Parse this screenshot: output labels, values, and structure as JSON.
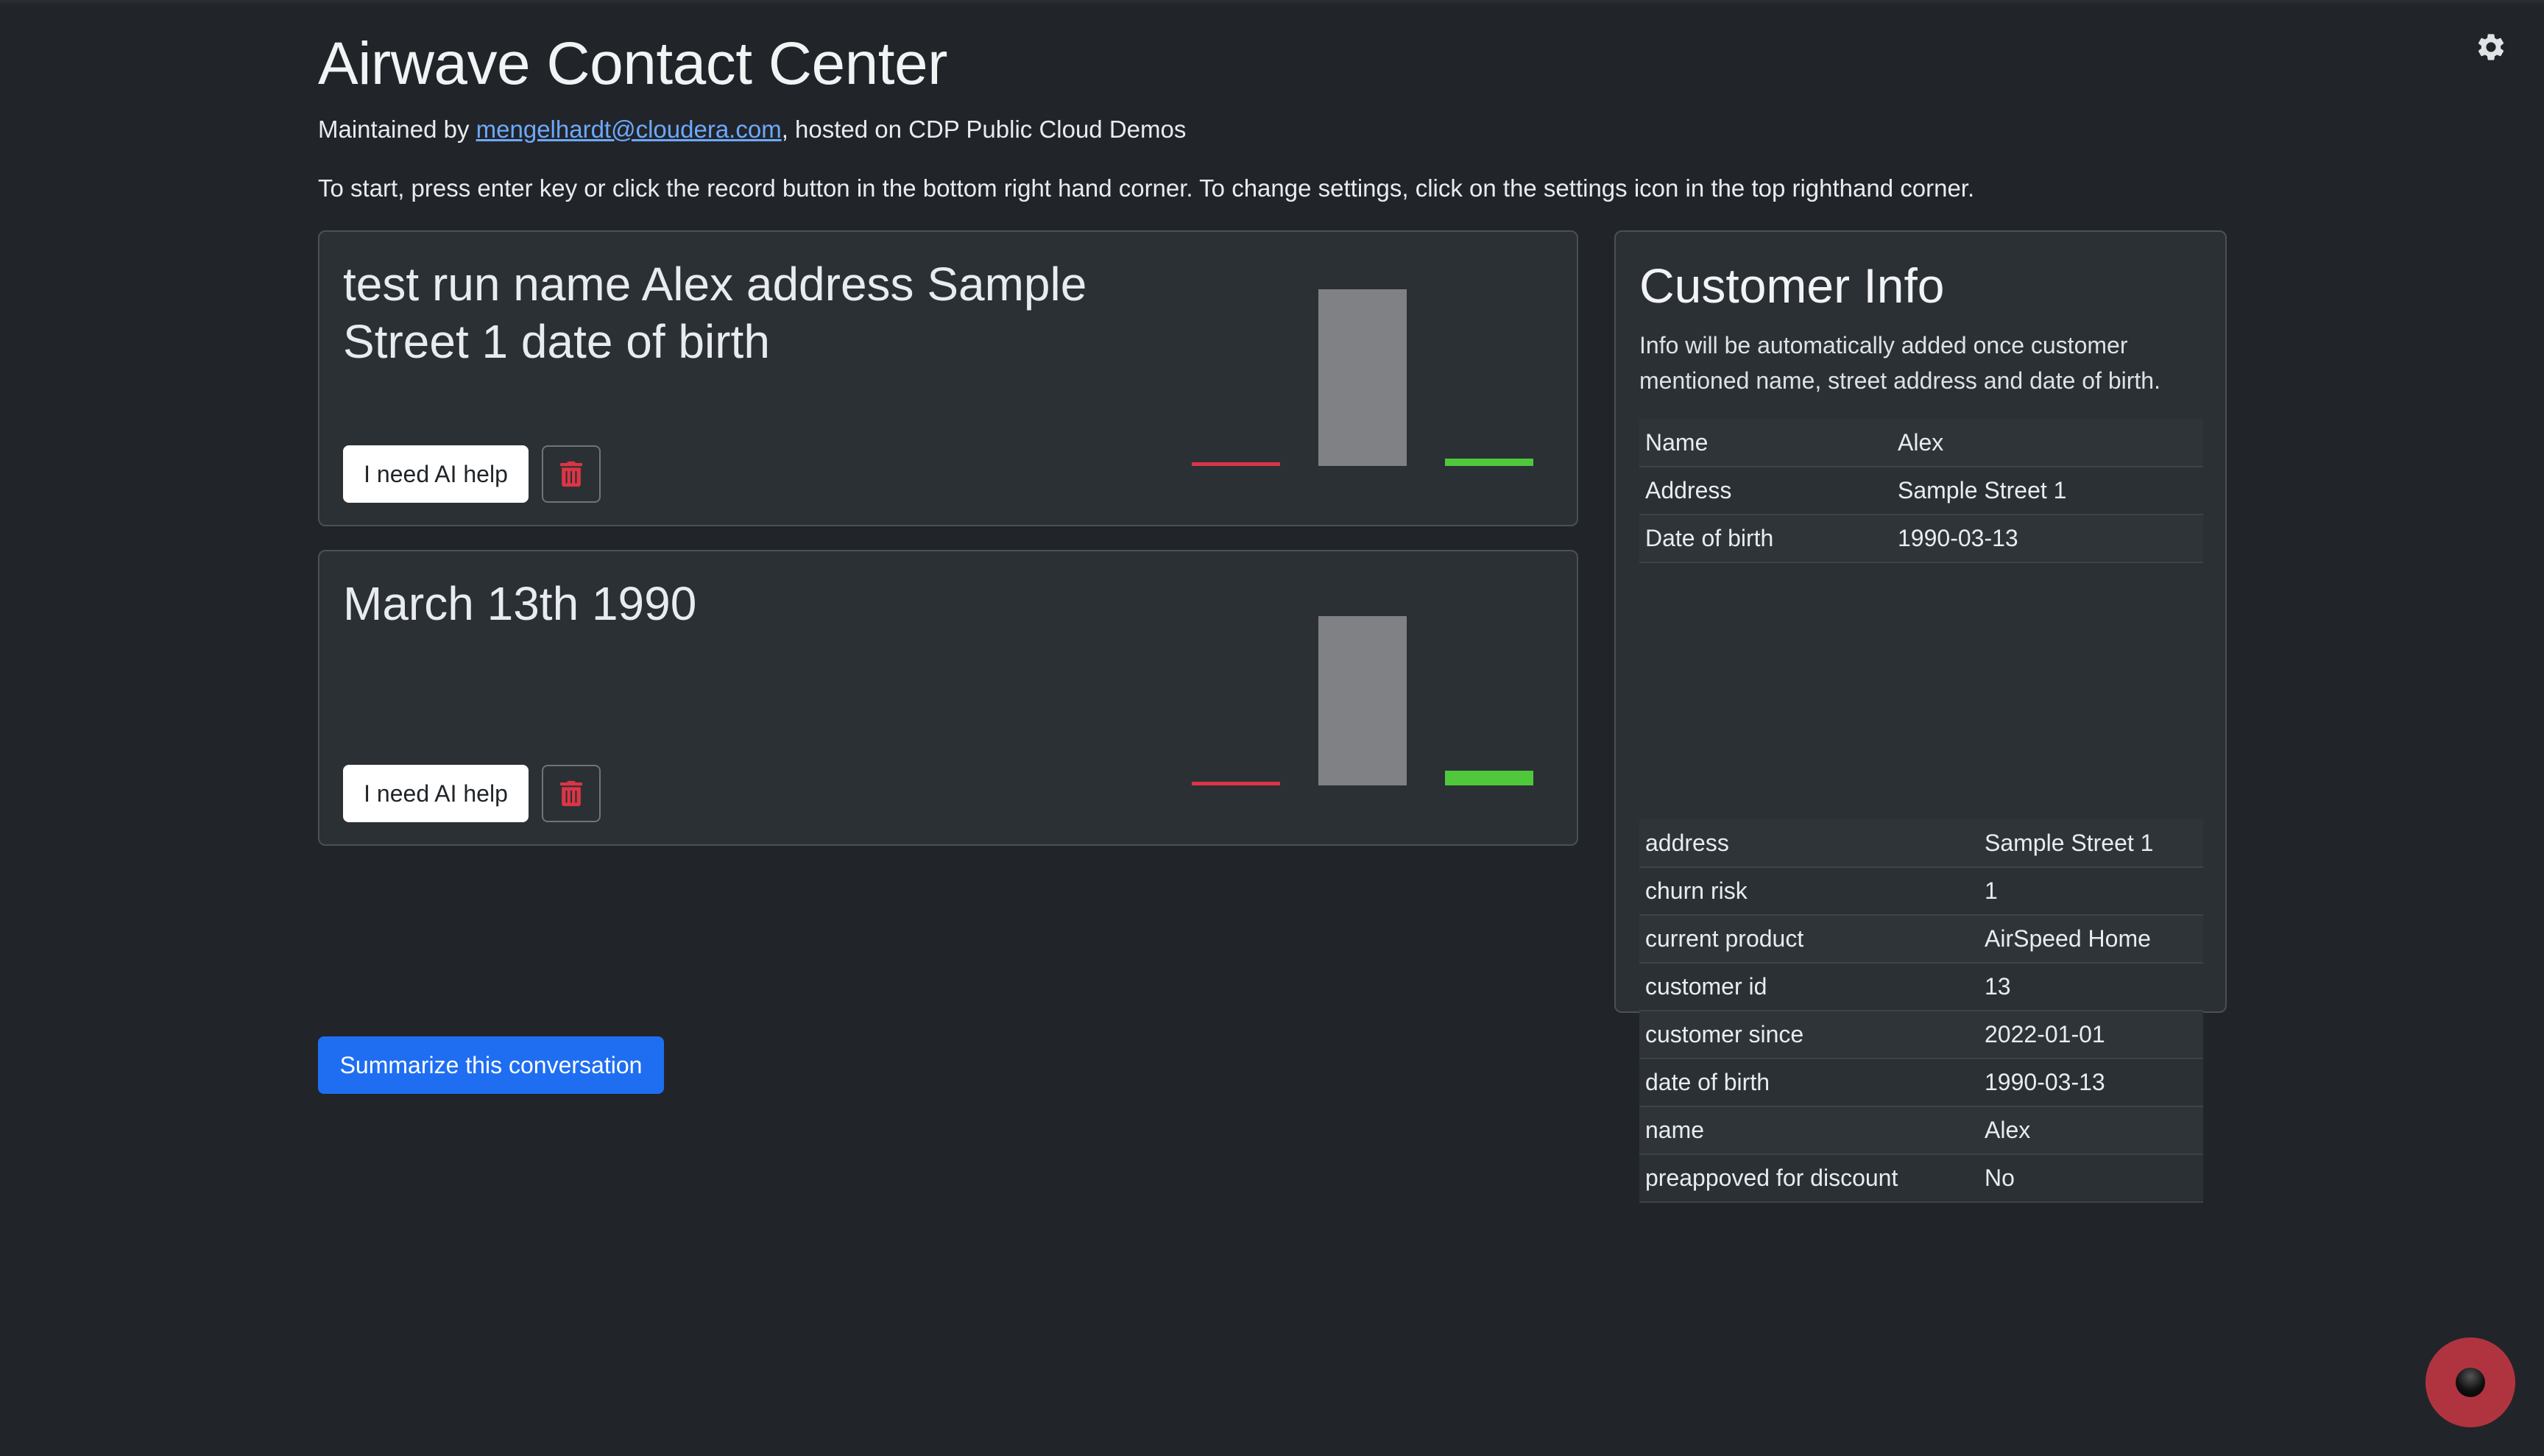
{
  "header": {
    "title": "Airwave Contact Center",
    "maintained_prefix": "Maintained by ",
    "maintainer_email": "mengelhardt@cloudera.com",
    "maintained_suffix": ", hosted on CDP Public Cloud Demos",
    "instructions": "To start, press enter key or click the record button in the bottom right hand corner. To change settings, click on the settings icon in the top righthand corner."
  },
  "transcripts": [
    {
      "text": "test run name Alex address Sample Street 1 date of birth",
      "help_label": "I need AI help",
      "sentiment": {
        "negative": 0.02,
        "neutral": 0.96,
        "positive": 0.04
      }
    },
    {
      "text": "March 13th 1990",
      "help_label": "I need AI help",
      "sentiment": {
        "negative": 0.02,
        "neutral": 0.92,
        "positive": 0.08
      }
    }
  ],
  "summarize_label": "Summarize this conversation",
  "customer": {
    "title": "Customer Info",
    "note": "Info will be automatically added once customer mentioned name, street address and date of birth.",
    "basic": [
      {
        "key": "Name",
        "value": "Alex"
      },
      {
        "key": "Address",
        "value": "Sample Street 1"
      },
      {
        "key": "Date of birth",
        "value": "1990-03-13"
      }
    ],
    "details": [
      {
        "key": "address",
        "value": "Sample Street 1"
      },
      {
        "key": "churn risk",
        "value": "1"
      },
      {
        "key": "current product",
        "value": "AirSpeed Home"
      },
      {
        "key": "customer id",
        "value": "13"
      },
      {
        "key": "customer since",
        "value": "2022-01-01"
      },
      {
        "key": "date of birth",
        "value": "1990-03-13"
      },
      {
        "key": "name",
        "value": "Alex"
      },
      {
        "key": "preappoved for discount",
        "value": "No"
      }
    ]
  },
  "icons": {
    "settings": "gear-icon",
    "delete": "trash-icon",
    "record": "record-icon"
  },
  "colors": {
    "background": "#212529",
    "card": "#2b3035",
    "primary": "#1f6ef2",
    "negative": "#dc3545",
    "neutral": "#808185",
    "positive": "#4fc83c",
    "record": "#b0343f",
    "link": "#6ea8fe"
  }
}
